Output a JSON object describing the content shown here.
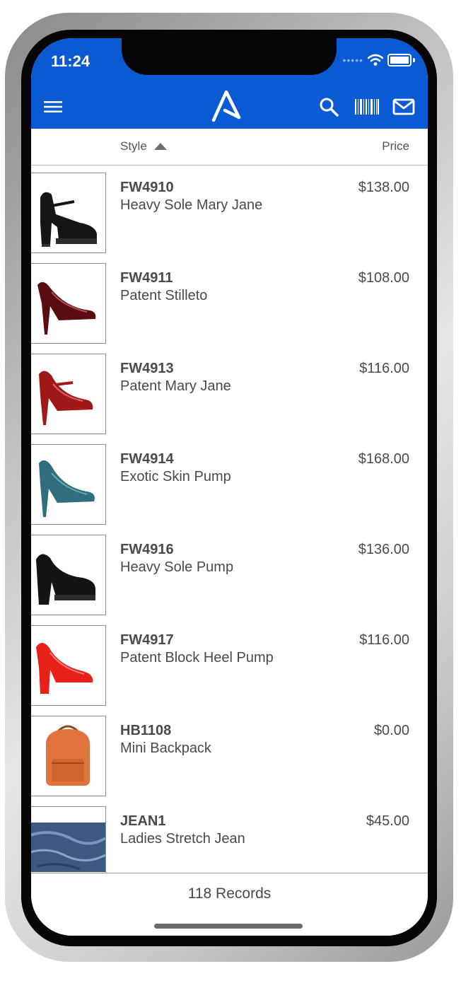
{
  "status_bar": {
    "time": "11:24"
  },
  "nav": {
    "menu_icon": "hamburger-menu-icon",
    "logo_icon": "app-logo-a-icon",
    "search_icon": "search-icon",
    "barcode_icon": "barcode-scan-icon",
    "mail_icon": "mail-icon"
  },
  "columns": {
    "style_label": "Style",
    "sort_direction": "ascending",
    "price_label": "Price"
  },
  "products": [
    {
      "code": "FW4910",
      "name": "Heavy Sole Mary Jane",
      "price": "$138.00",
      "image": "black-platform-mary-jane"
    },
    {
      "code": "FW4911",
      "name": "Patent Stilleto",
      "price": "$108.00",
      "image": "burgundy-patent-stiletto"
    },
    {
      "code": "FW4913",
      "name": "Patent Mary Jane",
      "price": "$116.00",
      "image": "red-patent-mary-jane"
    },
    {
      "code": "FW4914",
      "name": "Exotic Skin Pump",
      "price": "$168.00",
      "image": "teal-exotic-pump"
    },
    {
      "code": "FW4916",
      "name": "Heavy Sole Pump",
      "price": "$136.00",
      "image": "black-platform-pump"
    },
    {
      "code": "FW4917",
      "name": "Patent Block Heel Pump",
      "price": "$116.00",
      "image": "red-block-heel-pump"
    },
    {
      "code": "HB1108",
      "name": "Mini Backpack",
      "price": "$0.00",
      "image": "orange-leather-backpack"
    },
    {
      "code": "JEAN1",
      "name": "Ladies Stretch Jean",
      "price": "$45.00",
      "image": "denim-fabric"
    }
  ],
  "footer": {
    "records_text": "118 Records"
  },
  "colors": {
    "header_blue": "#0a5ad4",
    "text": "#4a4a4a"
  }
}
